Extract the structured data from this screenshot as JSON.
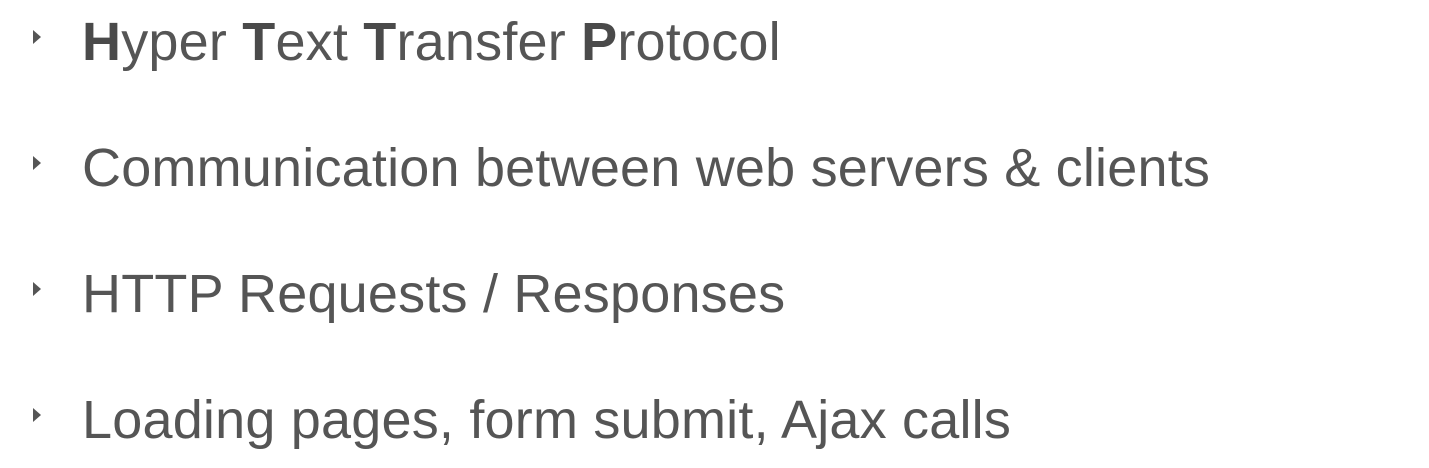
{
  "bullets": [
    {
      "segments": [
        {
          "text": "H",
          "bold": true
        },
        {
          "text": "yper ",
          "bold": false
        },
        {
          "text": "T",
          "bold": true
        },
        {
          "text": "ext ",
          "bold": false
        },
        {
          "text": "T",
          "bold": true
        },
        {
          "text": "ransfer ",
          "bold": false
        },
        {
          "text": "P",
          "bold": true
        },
        {
          "text": "rotocol",
          "bold": false
        }
      ]
    },
    {
      "segments": [
        {
          "text": "Communication between web servers & clients",
          "bold": false
        }
      ]
    },
    {
      "segments": [
        {
          "text": "HTTP Requests / Responses",
          "bold": false
        }
      ]
    },
    {
      "segments": [
        {
          "text": "Loading pages, form submit, Ajax calls",
          "bold": false
        }
      ]
    }
  ],
  "colors": {
    "text": "#555555",
    "marker": "#555555",
    "background": "#ffffff"
  },
  "icons": {
    "marker": "triangle-bullet-icon"
  }
}
